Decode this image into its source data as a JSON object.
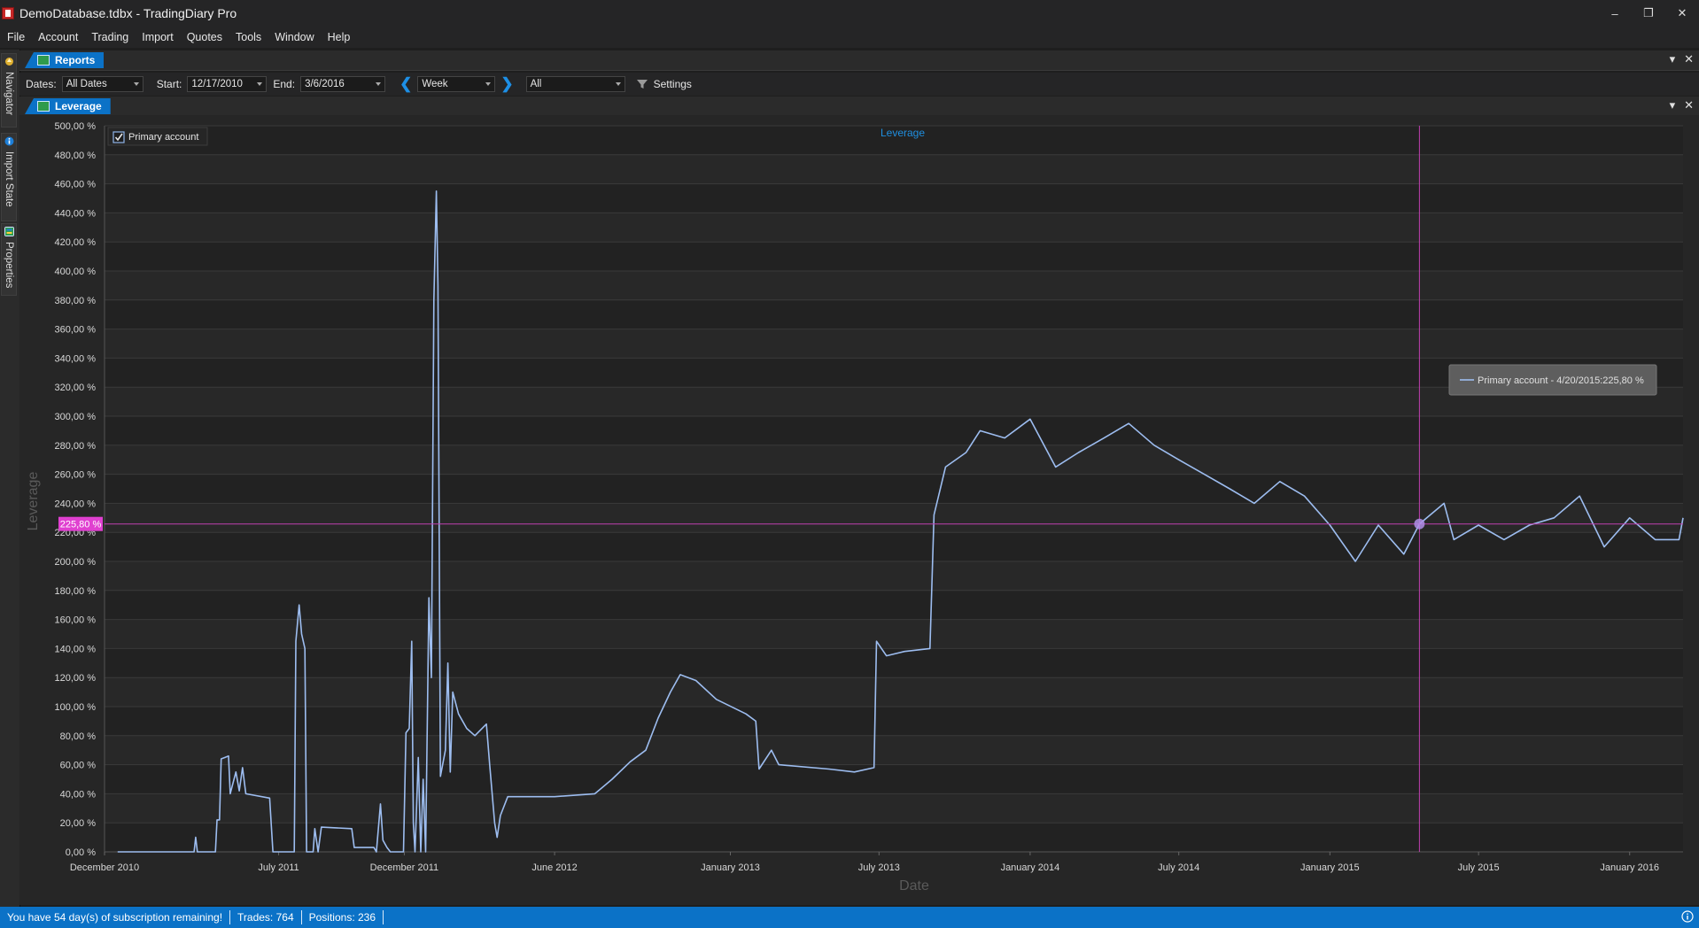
{
  "window": {
    "title": "DemoDatabase.tdbx - TradingDiary Pro",
    "minimize_glyph": "–",
    "restore_glyph": "❐",
    "close_glyph": "✕"
  },
  "menu": [
    "File",
    "Account",
    "Trading",
    "Import",
    "Quotes",
    "Tools",
    "Window",
    "Help"
  ],
  "side_tabs": [
    {
      "label": "Navigator",
      "icon": "navigator-icon"
    },
    {
      "label": "Import State",
      "icon": "info-icon"
    },
    {
      "label": "Properties",
      "icon": "properties-icon"
    }
  ],
  "reports_tab": {
    "label": "Reports",
    "dropdown_glyph": "▾",
    "close_glyph": "✕"
  },
  "toolbar": {
    "dates_label": "Dates:",
    "dates_value": "All Dates",
    "start_label": "Start:",
    "start_value": "12/17/2010",
    "end_label": "End:",
    "end_value": "3/6/2016",
    "prev_glyph": "❮",
    "next_glyph": "❯",
    "period_value": "Week",
    "filter_value": "All",
    "settings_label": "Settings"
  },
  "leverage_tab": {
    "label": "Leverage",
    "dropdown_glyph": "▾",
    "close_glyph": "✕"
  },
  "chart_data": {
    "type": "line",
    "title": "Leverage",
    "xlabel": "Date",
    "ylabel": "Leverage",
    "ylim": [
      0,
      500
    ],
    "y_ticks": [
      0,
      20,
      40,
      60,
      80,
      100,
      120,
      140,
      160,
      180,
      200,
      220,
      240,
      260,
      280,
      300,
      320,
      340,
      360,
      380,
      400,
      420,
      440,
      460,
      480,
      500
    ],
    "y_tick_labels": [
      "0,00 %",
      "20,00 %",
      "40,00 %",
      "60,00 %",
      "80,00 %",
      "100,00 %",
      "120,00 %",
      "140,00 %",
      "160,00 %",
      "180,00 %",
      "200,00 %",
      "220,00 %",
      "240,00 %",
      "260,00 %",
      "280,00 %",
      "300,00 %",
      "320,00 %",
      "340,00 %",
      "360,00 %",
      "380,00 %",
      "400,00 %",
      "420,00 %",
      "440,00 %",
      "460,00 %",
      "480,00 %",
      "500,00 %"
    ],
    "x_ticks": [
      {
        "date": "2010-12-01",
        "label": "December 2010"
      },
      {
        "date": "2011-07-01",
        "label": "July 2011"
      },
      {
        "date": "2011-12-01",
        "label": "December 2011"
      },
      {
        "date": "2012-06-01",
        "label": "June 2012"
      },
      {
        "date": "2013-01-01",
        "label": "January 2013"
      },
      {
        "date": "2013-07-01",
        "label": "July 2013"
      },
      {
        "date": "2014-01-01",
        "label": "January 2014"
      },
      {
        "date": "2014-07-01",
        "label": "July 2014"
      },
      {
        "date": "2015-01-01",
        "label": "January 2015"
      },
      {
        "date": "2015-07-01",
        "label": "July 2015"
      },
      {
        "date": "2016-01-01",
        "label": "January 2016"
      }
    ],
    "xlim": [
      "2010-12-01",
      "2016-03-06"
    ],
    "grid": true,
    "legend_position": "top-left",
    "series": [
      {
        "name": "Primary account",
        "color": "#9dbdf0",
        "points": [
          [
            "2010-12-17",
            0
          ],
          [
            "2011-03-20",
            0
          ],
          [
            "2011-03-22",
            10
          ],
          [
            "2011-03-24",
            0
          ],
          [
            "2011-04-15",
            0
          ],
          [
            "2011-04-17",
            22
          ],
          [
            "2011-04-20",
            22
          ],
          [
            "2011-04-22",
            64
          ],
          [
            "2011-05-01",
            66
          ],
          [
            "2011-05-03",
            40
          ],
          [
            "2011-05-10",
            55
          ],
          [
            "2011-05-14",
            42
          ],
          [
            "2011-05-18",
            58
          ],
          [
            "2011-05-22",
            40
          ],
          [
            "2011-06-20",
            37
          ],
          [
            "2011-06-24",
            0
          ],
          [
            "2011-07-20",
            0
          ],
          [
            "2011-07-22",
            145
          ],
          [
            "2011-07-26",
            170
          ],
          [
            "2011-07-29",
            150
          ],
          [
            "2011-08-02",
            140
          ],
          [
            "2011-08-04",
            0
          ],
          [
            "2011-08-12",
            0
          ],
          [
            "2011-08-14",
            16
          ],
          [
            "2011-08-18",
            0
          ],
          [
            "2011-08-22",
            17
          ],
          [
            "2011-09-28",
            16
          ],
          [
            "2011-10-01",
            3
          ],
          [
            "2011-10-25",
            3
          ],
          [
            "2011-10-28",
            0
          ],
          [
            "2011-11-02",
            33
          ],
          [
            "2011-11-05",
            8
          ],
          [
            "2011-11-10",
            3
          ],
          [
            "2011-11-14",
            0
          ],
          [
            "2011-11-30",
            0
          ],
          [
            "2011-12-03",
            82
          ],
          [
            "2011-12-07",
            85
          ],
          [
            "2011-12-10",
            145
          ],
          [
            "2011-12-12",
            20
          ],
          [
            "2011-12-14",
            0
          ],
          [
            "2011-12-18",
            65
          ],
          [
            "2011-12-21",
            0
          ],
          [
            "2011-12-24",
            50
          ],
          [
            "2011-12-27",
            0
          ],
          [
            "2011-12-31",
            175
          ],
          [
            "2012-01-03",
            120
          ],
          [
            "2012-01-06",
            380
          ],
          [
            "2012-01-09",
            455
          ],
          [
            "2012-01-11",
            390
          ],
          [
            "2012-01-14",
            52
          ],
          [
            "2012-01-20",
            70
          ],
          [
            "2012-01-23",
            130
          ],
          [
            "2012-01-26",
            55
          ],
          [
            "2012-01-29",
            110
          ],
          [
            "2012-02-05",
            95
          ],
          [
            "2012-02-15",
            85
          ],
          [
            "2012-02-25",
            80
          ],
          [
            "2012-03-10",
            88
          ],
          [
            "2012-03-14",
            60
          ],
          [
            "2012-03-20",
            20
          ],
          [
            "2012-03-23",
            10
          ],
          [
            "2012-03-27",
            25
          ],
          [
            "2012-04-05",
            38
          ],
          [
            "2012-06-01",
            38
          ],
          [
            "2012-07-20",
            40
          ],
          [
            "2012-08-10",
            50
          ],
          [
            "2012-09-01",
            62
          ],
          [
            "2012-09-20",
            70
          ],
          [
            "2012-10-05",
            92
          ],
          [
            "2012-10-20",
            110
          ],
          [
            "2012-11-01",
            122
          ],
          [
            "2012-11-20",
            118
          ],
          [
            "2012-12-15",
            105
          ],
          [
            "2013-01-20",
            95
          ],
          [
            "2013-02-01",
            90
          ],
          [
            "2013-02-05",
            57
          ],
          [
            "2013-02-20",
            70
          ],
          [
            "2013-03-01",
            60
          ],
          [
            "2013-05-01",
            57
          ],
          [
            "2013-06-01",
            55
          ],
          [
            "2013-06-25",
            58
          ],
          [
            "2013-06-28",
            145
          ],
          [
            "2013-07-10",
            135
          ],
          [
            "2013-08-01",
            138
          ],
          [
            "2013-09-01",
            140
          ],
          [
            "2013-09-06",
            232
          ],
          [
            "2013-09-20",
            265
          ],
          [
            "2013-10-15",
            275
          ],
          [
            "2013-11-01",
            290
          ],
          [
            "2013-12-01",
            285
          ],
          [
            "2014-01-01",
            298
          ],
          [
            "2014-02-01",
            265
          ],
          [
            "2014-03-01",
            275
          ],
          [
            "2014-04-01",
            285
          ],
          [
            "2014-05-01",
            295
          ],
          [
            "2014-06-01",
            280
          ],
          [
            "2014-07-01",
            270
          ],
          [
            "2014-08-01",
            260
          ],
          [
            "2014-09-01",
            250
          ],
          [
            "2014-10-01",
            240
          ],
          [
            "2014-11-01",
            255
          ],
          [
            "2014-12-01",
            245
          ],
          [
            "2015-01-01",
            225
          ],
          [
            "2015-02-01",
            200
          ],
          [
            "2015-03-01",
            225
          ],
          [
            "2015-04-01",
            205
          ],
          [
            "2015-04-20",
            225.8
          ],
          [
            "2015-05-20",
            240
          ],
          [
            "2015-06-01",
            215
          ],
          [
            "2015-07-01",
            225
          ],
          [
            "2015-08-01",
            215
          ],
          [
            "2015-09-01",
            225
          ],
          [
            "2015-10-01",
            230
          ],
          [
            "2015-11-01",
            245
          ],
          [
            "2015-12-01",
            210
          ],
          [
            "2016-01-01",
            230
          ],
          [
            "2016-02-01",
            215
          ],
          [
            "2016-03-01",
            215
          ],
          [
            "2016-03-06",
            230
          ]
        ]
      }
    ],
    "crosshair": {
      "date": "2015-04-20",
      "value": 225.8,
      "value_label": "225,80 %"
    },
    "tooltip": {
      "text": "Primary account - 4/20/2015:225,80 %"
    }
  },
  "status": {
    "subscription": "You have 54 day(s) of subscription remaining!",
    "trades": "Trades: 764",
    "positions": "Positions: 236"
  },
  "colors": {
    "accent": "#0b72c7",
    "series": "#9dbdf0",
    "crosshair": "#c040b0",
    "value_badge": "#e040d0",
    "title_text": "#1f8fe0"
  }
}
